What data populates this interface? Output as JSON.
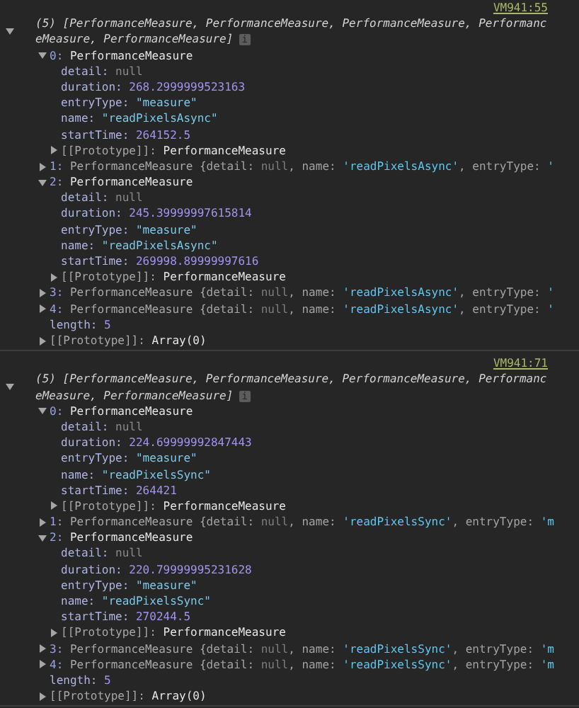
{
  "groups": [
    {
      "source": "VM941:55",
      "header": {
        "expanded": true,
        "text": "(5) [PerformanceMeasure, PerformanceMeasure, PerformanceMeasure, PerformanceMeasure, PerformanceMeasure]",
        "badge": "i"
      },
      "rows": [
        {
          "expanded": true,
          "segments": [
            {
              "text": "0:",
              "kind": "index"
            },
            {
              "text": " PerformanceMeasure",
              "kind": "class"
            }
          ],
          "children": [
            {
              "segments": [
                {
                  "text": "detail:",
                  "kind": "key"
                },
                {
                  "text": " null",
                  "kind": "null"
                }
              ]
            },
            {
              "segments": [
                {
                  "text": "duration:",
                  "kind": "key"
                },
                {
                  "text": " 268.2999999523163",
                  "kind": "number"
                }
              ]
            },
            {
              "segments": [
                {
                  "text": "entryType:",
                  "kind": "key"
                },
                {
                  "text": " \"measure\"",
                  "kind": "string"
                }
              ]
            },
            {
              "segments": [
                {
                  "text": "name:",
                  "kind": "key"
                },
                {
                  "text": " \"readPixelsAsync\"",
                  "kind": "string"
                }
              ]
            },
            {
              "segments": [
                {
                  "text": "startTime:",
                  "kind": "key"
                },
                {
                  "text": " 264152.5",
                  "kind": "number"
                }
              ]
            },
            {
              "expanded": false,
              "segments": [
                {
                  "text": "[[Prototype]]:",
                  "kind": "proto"
                },
                {
                  "text": " PerformanceMeasure",
                  "kind": "class"
                }
              ]
            }
          ]
        },
        {
          "expanded": false,
          "segments": [
            {
              "text": "1:",
              "kind": "index"
            },
            {
              "text": " PerformanceMeasure {",
              "kind": "pclass"
            },
            {
              "text": "detail:",
              "kind": "pkey"
            },
            {
              "text": " null",
              "kind": "pnull"
            },
            {
              "text": ", name:",
              "kind": "pkey"
            },
            {
              "text": " 'readPixelsAsync'",
              "kind": "pstring"
            },
            {
              "text": ", entryType:",
              "kind": "pkey"
            },
            {
              "text": " '",
              "kind": "pstring"
            }
          ]
        },
        {
          "expanded": true,
          "segments": [
            {
              "text": "2:",
              "kind": "index"
            },
            {
              "text": " PerformanceMeasure",
              "kind": "class"
            }
          ],
          "children": [
            {
              "segments": [
                {
                  "text": "detail:",
                  "kind": "key"
                },
                {
                  "text": " null",
                  "kind": "null"
                }
              ]
            },
            {
              "segments": [
                {
                  "text": "duration:",
                  "kind": "key"
                },
                {
                  "text": " 245.39999997615814",
                  "kind": "number"
                }
              ]
            },
            {
              "segments": [
                {
                  "text": "entryType:",
                  "kind": "key"
                },
                {
                  "text": " \"measure\"",
                  "kind": "string"
                }
              ]
            },
            {
              "segments": [
                {
                  "text": "name:",
                  "kind": "key"
                },
                {
                  "text": " \"readPixelsAsync\"",
                  "kind": "string"
                }
              ]
            },
            {
              "segments": [
                {
                  "text": "startTime:",
                  "kind": "key"
                },
                {
                  "text": " 269998.89999997616",
                  "kind": "number"
                }
              ]
            },
            {
              "expanded": false,
              "segments": [
                {
                  "text": "[[Prototype]]:",
                  "kind": "proto"
                },
                {
                  "text": " PerformanceMeasure",
                  "kind": "class"
                }
              ]
            }
          ]
        },
        {
          "expanded": false,
          "segments": [
            {
              "text": "3:",
              "kind": "index"
            },
            {
              "text": " PerformanceMeasure {",
              "kind": "pclass"
            },
            {
              "text": "detail:",
              "kind": "pkey"
            },
            {
              "text": " null",
              "kind": "pnull"
            },
            {
              "text": ", name:",
              "kind": "pkey"
            },
            {
              "text": " 'readPixelsAsync'",
              "kind": "pstring"
            },
            {
              "text": ", entryType:",
              "kind": "pkey"
            },
            {
              "text": " '",
              "kind": "pstring"
            }
          ]
        },
        {
          "expanded": false,
          "segments": [
            {
              "text": "4:",
              "kind": "index"
            },
            {
              "text": " PerformanceMeasure {",
              "kind": "pclass"
            },
            {
              "text": "detail:",
              "kind": "pkey"
            },
            {
              "text": " null",
              "kind": "pnull"
            },
            {
              "text": ", name:",
              "kind": "pkey"
            },
            {
              "text": " 'readPixelsAsync'",
              "kind": "pstring"
            },
            {
              "text": ", entryType:",
              "kind": "pkey"
            },
            {
              "text": " '",
              "kind": "pstring"
            }
          ]
        },
        {
          "segments": [
            {
              "text": "length:",
              "kind": "key"
            },
            {
              "text": " 5",
              "kind": "number"
            }
          ]
        },
        {
          "expanded": false,
          "segments": [
            {
              "text": "[[Prototype]]:",
              "kind": "proto"
            },
            {
              "text": " Array(0)",
              "kind": "class"
            }
          ]
        }
      ]
    },
    {
      "source": "VM941:71",
      "header": {
        "expanded": true,
        "text": "(5) [PerformanceMeasure, PerformanceMeasure, PerformanceMeasure, PerformanceMeasure, PerformanceMeasure]",
        "badge": "i"
      },
      "rows": [
        {
          "expanded": true,
          "segments": [
            {
              "text": "0:",
              "kind": "index"
            },
            {
              "text": " PerformanceMeasure",
              "kind": "class"
            }
          ],
          "children": [
            {
              "segments": [
                {
                  "text": "detail:",
                  "kind": "key"
                },
                {
                  "text": " null",
                  "kind": "null"
                }
              ]
            },
            {
              "segments": [
                {
                  "text": "duration:",
                  "kind": "key"
                },
                {
                  "text": " 224.69999992847443",
                  "kind": "number"
                }
              ]
            },
            {
              "segments": [
                {
                  "text": "entryType:",
                  "kind": "key"
                },
                {
                  "text": " \"measure\"",
                  "kind": "string"
                }
              ]
            },
            {
              "segments": [
                {
                  "text": "name:",
                  "kind": "key"
                },
                {
                  "text": " \"readPixelsSync\"",
                  "kind": "string"
                }
              ]
            },
            {
              "segments": [
                {
                  "text": "startTime:",
                  "kind": "key"
                },
                {
                  "text": " 264421",
                  "kind": "number"
                }
              ]
            },
            {
              "expanded": false,
              "segments": [
                {
                  "text": "[[Prototype]]:",
                  "kind": "proto"
                },
                {
                  "text": " PerformanceMeasure",
                  "kind": "class"
                }
              ]
            }
          ]
        },
        {
          "expanded": false,
          "segments": [
            {
              "text": "1:",
              "kind": "index"
            },
            {
              "text": " PerformanceMeasure {",
              "kind": "pclass"
            },
            {
              "text": "detail:",
              "kind": "pkey"
            },
            {
              "text": " null",
              "kind": "pnull"
            },
            {
              "text": ", name:",
              "kind": "pkey"
            },
            {
              "text": " 'readPixelsSync'",
              "kind": "pstring"
            },
            {
              "text": ", entryType:",
              "kind": "pkey"
            },
            {
              "text": " 'm",
              "kind": "pstring"
            }
          ]
        },
        {
          "expanded": true,
          "segments": [
            {
              "text": "2:",
              "kind": "index"
            },
            {
              "text": " PerformanceMeasure",
              "kind": "class"
            }
          ],
          "children": [
            {
              "segments": [
                {
                  "text": "detail:",
                  "kind": "key"
                },
                {
                  "text": " null",
                  "kind": "null"
                }
              ]
            },
            {
              "segments": [
                {
                  "text": "duration:",
                  "kind": "key"
                },
                {
                  "text": " 220.79999995231628",
                  "kind": "number"
                }
              ]
            },
            {
              "segments": [
                {
                  "text": "entryType:",
                  "kind": "key"
                },
                {
                  "text": " \"measure\"",
                  "kind": "string"
                }
              ]
            },
            {
              "segments": [
                {
                  "text": "name:",
                  "kind": "key"
                },
                {
                  "text": " \"readPixelsSync\"",
                  "kind": "string"
                }
              ]
            },
            {
              "segments": [
                {
                  "text": "startTime:",
                  "kind": "key"
                },
                {
                  "text": " 270244.5",
                  "kind": "number"
                }
              ]
            },
            {
              "expanded": false,
              "segments": [
                {
                  "text": "[[Prototype]]:",
                  "kind": "proto"
                },
                {
                  "text": " PerformanceMeasure",
                  "kind": "class"
                }
              ]
            }
          ]
        },
        {
          "expanded": false,
          "segments": [
            {
              "text": "3:",
              "kind": "index"
            },
            {
              "text": " PerformanceMeasure {",
              "kind": "pclass"
            },
            {
              "text": "detail:",
              "kind": "pkey"
            },
            {
              "text": " null",
              "kind": "pnull"
            },
            {
              "text": ", name:",
              "kind": "pkey"
            },
            {
              "text": " 'readPixelsSync'",
              "kind": "pstring"
            },
            {
              "text": ", entryType:",
              "kind": "pkey"
            },
            {
              "text": " 'm",
              "kind": "pstring"
            }
          ]
        },
        {
          "expanded": false,
          "segments": [
            {
              "text": "4:",
              "kind": "index"
            },
            {
              "text": " PerformanceMeasure {",
              "kind": "pclass"
            },
            {
              "text": "detail:",
              "kind": "pkey"
            },
            {
              "text": " null",
              "kind": "pnull"
            },
            {
              "text": ", name:",
              "kind": "pkey"
            },
            {
              "text": " 'readPixelsSync'",
              "kind": "pstring"
            },
            {
              "text": ", entryType:",
              "kind": "pkey"
            },
            {
              "text": " 'm",
              "kind": "pstring"
            }
          ]
        },
        {
          "segments": [
            {
              "text": "length:",
              "kind": "key"
            },
            {
              "text": " 5",
              "kind": "number"
            }
          ]
        },
        {
          "expanded": false,
          "segments": [
            {
              "text": "[[Prototype]]:",
              "kind": "proto"
            },
            {
              "text": " Array(0)",
              "kind": "class"
            }
          ]
        }
      ]
    }
  ]
}
